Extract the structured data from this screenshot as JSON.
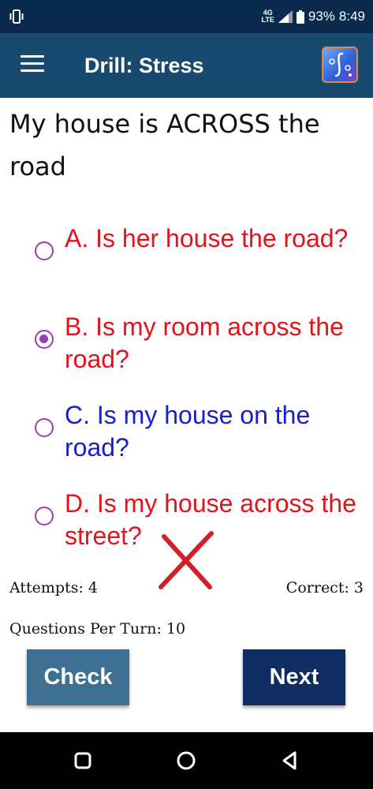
{
  "status_bar": {
    "network_top": "4G",
    "network_bottom": "LTE",
    "battery": "93%",
    "time": "8:49",
    "icons": [
      "vibrate-icon",
      "signal-icon",
      "battery-icon"
    ]
  },
  "app_bar": {
    "title": "Drill: Stress",
    "icons": [
      "menu-icon",
      "app-logo-icon"
    ]
  },
  "question": {
    "text": "My house is ACROSS the road"
  },
  "options": [
    {
      "label": "A. Is her house the road?",
      "selected": false,
      "color": "#e3121b"
    },
    {
      "label": "B. Is my room across the road?",
      "selected": true,
      "color": "#e3121b"
    },
    {
      "label": "C. Is my house on the road?",
      "selected": false,
      "color": "#1a20c9"
    },
    {
      "label": "D. Is my house across the street?",
      "selected": false,
      "color": "#e3121b"
    }
  ],
  "feedback": {
    "icon": "wrong-x-icon",
    "color": "#d0202a"
  },
  "stats": {
    "attempts": "Attempts: 4",
    "correct": "Correct: 3",
    "questions_per_turn": "Questions Per Turn: 10"
  },
  "buttons": {
    "check": "Check",
    "next": "Next"
  },
  "nav_bar": {
    "icons": [
      "recents-icon",
      "home-icon",
      "back-icon"
    ]
  },
  "colors": {
    "status_bar": "#0a2a4d",
    "app_bar": "#174a6e",
    "radio": "#9c3cb4",
    "check_button": "#3f6f93",
    "next_button": "#0f2c63"
  }
}
